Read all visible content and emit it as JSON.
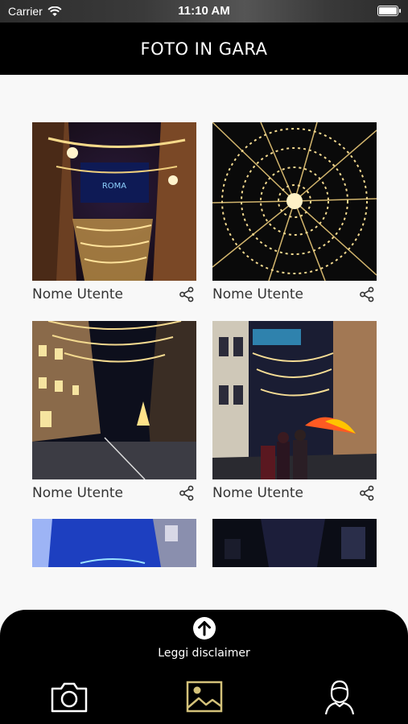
{
  "status_bar": {
    "carrier": "Carrier",
    "time": "11:10 AM"
  },
  "header": {
    "title": "FOTO IN GARA"
  },
  "photos": [
    {
      "username": "Nome Utente"
    },
    {
      "username": "Nome Utente"
    },
    {
      "username": "Nome Utente"
    },
    {
      "username": "Nome Utente"
    }
  ],
  "footer": {
    "disclaimer_label": "Leggi disclaimer"
  },
  "tabs": [
    {
      "icon": "camera-icon",
      "active": false
    },
    {
      "icon": "gallery-icon",
      "active": true
    },
    {
      "icon": "user-icon",
      "active": false
    }
  ],
  "colors": {
    "accent_gold": "#d4c27a",
    "background": "#f8f8f8",
    "header": "#000000"
  }
}
